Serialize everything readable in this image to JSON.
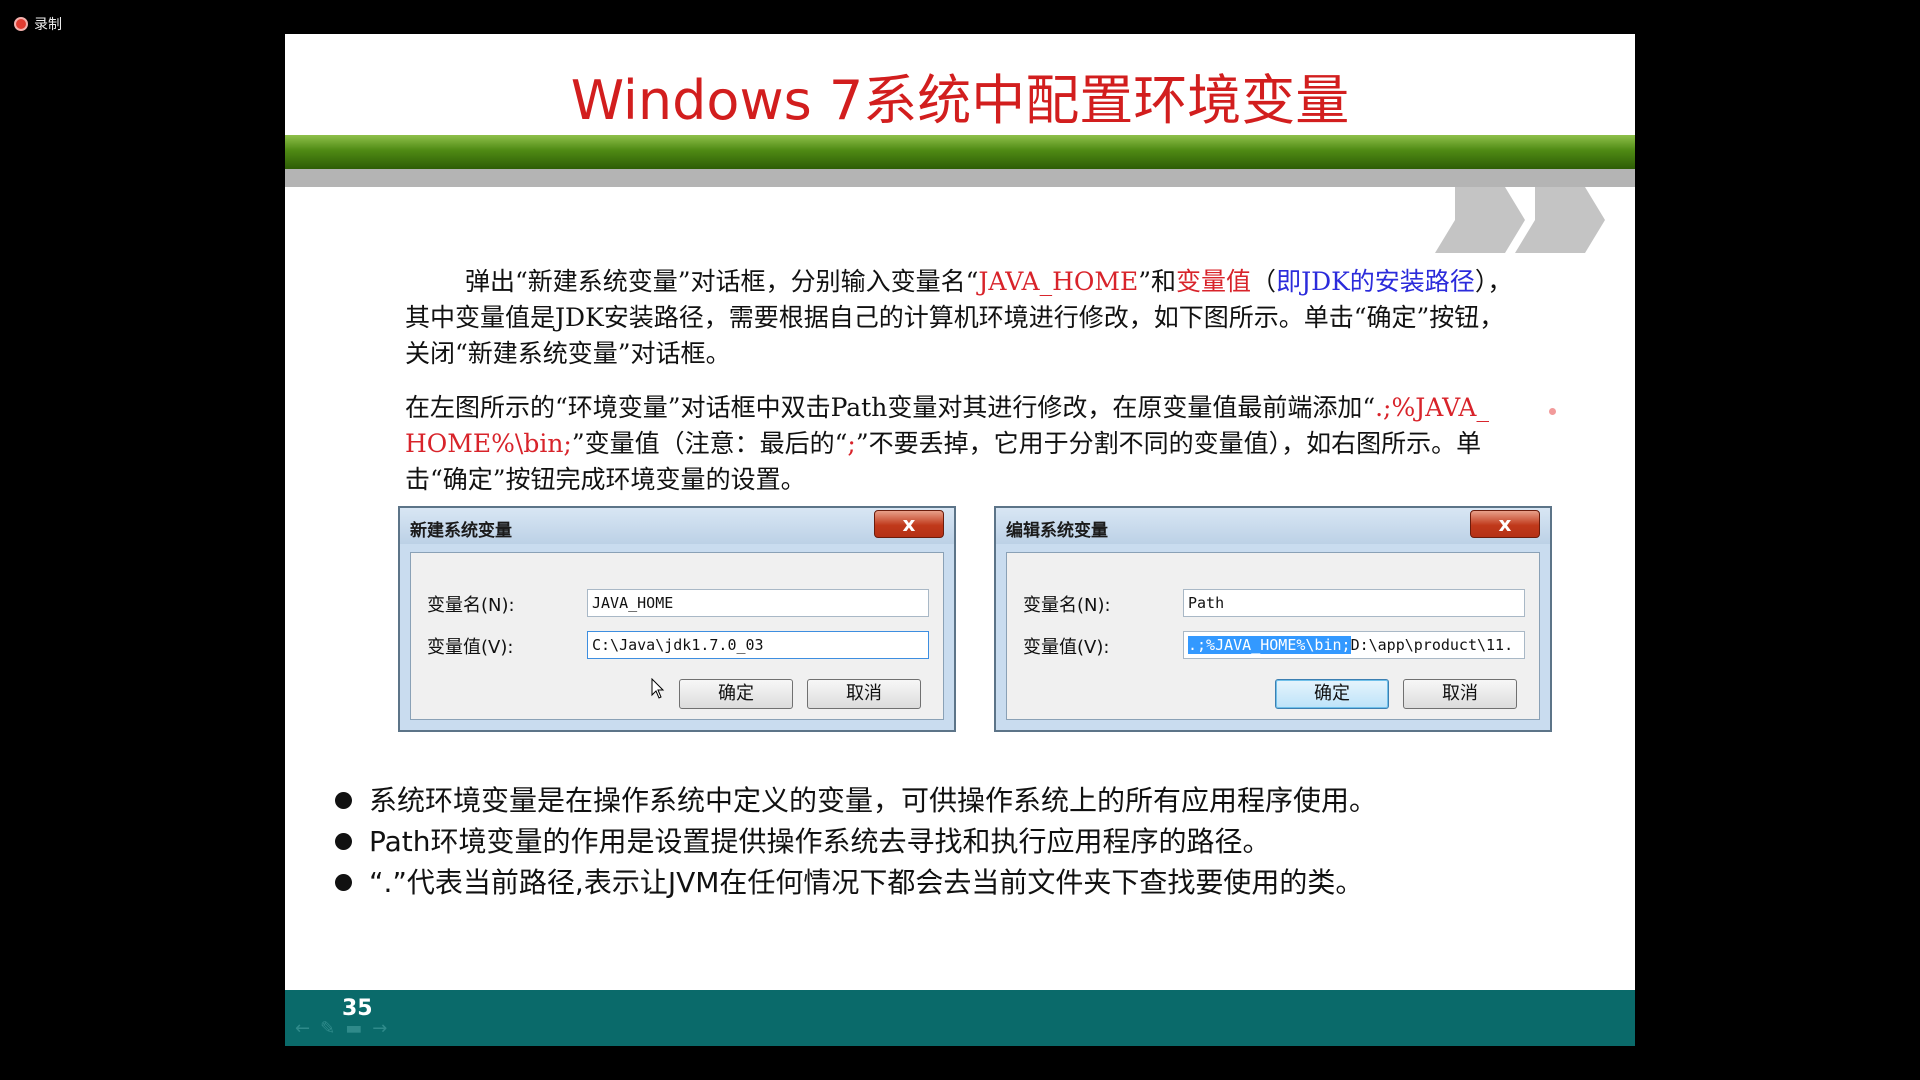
{
  "recording": {
    "label": "录制"
  },
  "slide": {
    "title": "Windows 7系统中配置环境变量",
    "page_number": "35",
    "paragraph1": {
      "a": "弹出“新建系统变量”对话框，分别输入变量名“",
      "b": "JAVA_HOME",
      "c": "”和",
      "d": "变量值",
      "e": "（",
      "f": "即JDK的安装路径",
      "g": "），其中变量值是JDK安装路径，需要根据自己的计算机环境进行修改，如下图所示。单击“确定”按钮，关闭“新建系统变量”对话框。"
    },
    "paragraph2": {
      "a": "在左图所示的“环境变量”对话框中双击Path变量对其进行修改，在原变量值最前端添加“",
      "b": ".;%JAVA_ HOME%\\bin;",
      "c": "”变量值（注意：最后的“",
      "d": ";",
      "e": "”不要丢掉，它用于分割不同的变量值），如右图所示。单击“确定”按钮完成环境变量的设置。"
    },
    "bullets": [
      "系统环境变量是在操作系统中定义的变量，可供操作系统上的所有应用程序使用。",
      "Path环境变量的作用是设置提供操作系统去寻找和执行应用程序的路径。",
      "“.”代表当前路径,表示让JVM在任何情况下都会去当前文件夹下查找要使用的类。"
    ]
  },
  "dialog_new": {
    "title": "新建系统变量",
    "close": "x",
    "name_label": "变量名(N):",
    "value_label": "变量值(V):",
    "name_value": "JAVA_HOME",
    "value_value": "C:\\Java\\jdk1.7.0_03",
    "ok": "确定",
    "cancel": "取消"
  },
  "dialog_edit": {
    "title": "编辑系统变量",
    "close": "x",
    "name_label": "变量名(N):",
    "value_label": "变量值(V):",
    "name_value": "Path",
    "value_selected": ".;%JAVA_HOME%\\bin;",
    "value_rest": "D:\\app\\product\\11.",
    "ok": "确定",
    "cancel": "取消"
  },
  "colors": {
    "title": "#d21e1e",
    "highlight_red": "#d8232a",
    "highlight_blue": "#2b2bdb",
    "footer": "#0a6a6a",
    "green_bar": "#4f8a14"
  }
}
